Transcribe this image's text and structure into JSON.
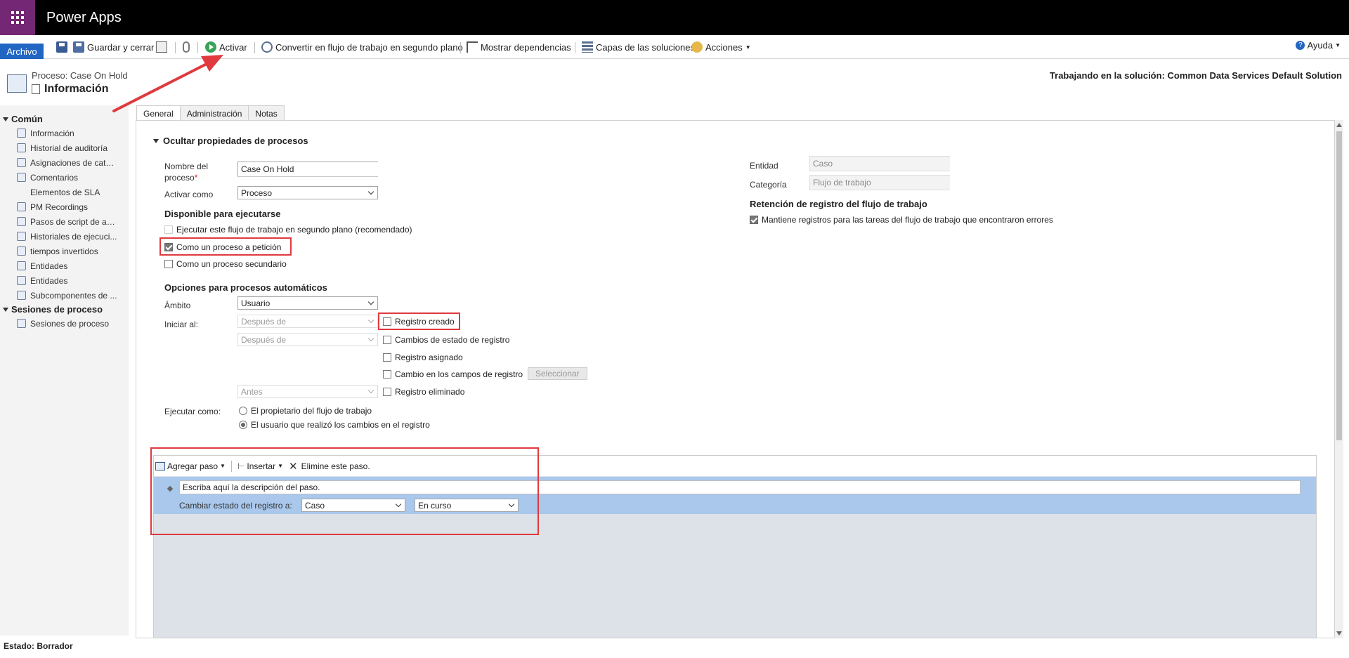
{
  "app": {
    "title": "Power Apps"
  },
  "ribbon": {
    "file": "Archivo",
    "save_close": "Guardar y cerrar",
    "activate": "Activar",
    "convert": "Convertir en flujo de trabajo en segundo plano",
    "dependencies": "Mostrar dependencias",
    "layers": "Capas de las soluciones",
    "actions": "Acciones",
    "help": "Ayuda"
  },
  "header": {
    "subtitle": "Proceso: Case On Hold",
    "title": "Información",
    "solution": "Trabajando en la solución: Common Data Services Default Solution"
  },
  "sidebar": {
    "sections": [
      {
        "title": "Común",
        "items": [
          "Información",
          "Historial de auditoría",
          "Asignaciones de catál...",
          "Comentarios",
          "Elementos de SLA",
          "PM Recordings",
          "Pasos de script de ag...",
          "Historiales de ejecuci...",
          "tiempos invertidos",
          "Entidades",
          "Entidades",
          "Subcomponentes de ..."
        ]
      },
      {
        "title": "Sesiones de proceso",
        "items": [
          "Sesiones de proceso"
        ]
      }
    ]
  },
  "tabs": [
    "General",
    "Administración",
    "Notas"
  ],
  "form": {
    "section_title": "Ocultar propiedades de procesos",
    "name_label_1": "Nombre del",
    "name_label_2": "proceso",
    "required_mark": "*",
    "name_value": "Case On Hold",
    "activate_as_label": "Activar como",
    "activate_as_value": "Proceso",
    "available_title": "Disponible para ejecutarse",
    "cb_background": "Ejecutar este flujo de trabajo en segundo plano (recomendado)",
    "cb_on_demand": "Como un proceso a petición",
    "cb_child": "Como un proceso secundario",
    "auto_title": "Opciones para procesos automáticos",
    "scope_label": "Ámbito",
    "scope_value": "Usuario",
    "start_label": "Iniciar al:",
    "after1": "Después de",
    "after2": "Después de",
    "before": "Antes",
    "record_created": "Registro creado",
    "status_change": "Cambios de estado de registro",
    "assigned": "Registro asignado",
    "field_change": "Cambio en los campos de registro",
    "select_btn": "Seleccionar",
    "deleted": "Registro eliminado",
    "run_as_label": "Ejecutar como:",
    "run_owner": "El propietario del flujo de trabajo",
    "run_user": "El usuario que realizó los cambios en el registro",
    "entity_label": "Entidad",
    "entity_value": "Caso",
    "category_label": "Categoría",
    "category_value": "Flujo de trabajo",
    "retention_title": "Retención de registro del flujo de trabajo",
    "retention_cb": "Mantiene registros para las tareas del flujo de trabajo que encontraron errores"
  },
  "workflow": {
    "add_step": "Agregar paso",
    "insert": "Insertar",
    "delete": "Elimine este paso.",
    "step_desc": "Escriba aquí la descripción del paso.",
    "change_label": "Cambiar estado del registro a:",
    "entity_select": "Caso",
    "status_select": "En curso"
  },
  "status": {
    "text": "Estado: Borrador"
  },
  "colors": {
    "accent_purple": "#742774",
    "highlight_red": "#e0393e",
    "step_blue": "#a9c8ec"
  }
}
